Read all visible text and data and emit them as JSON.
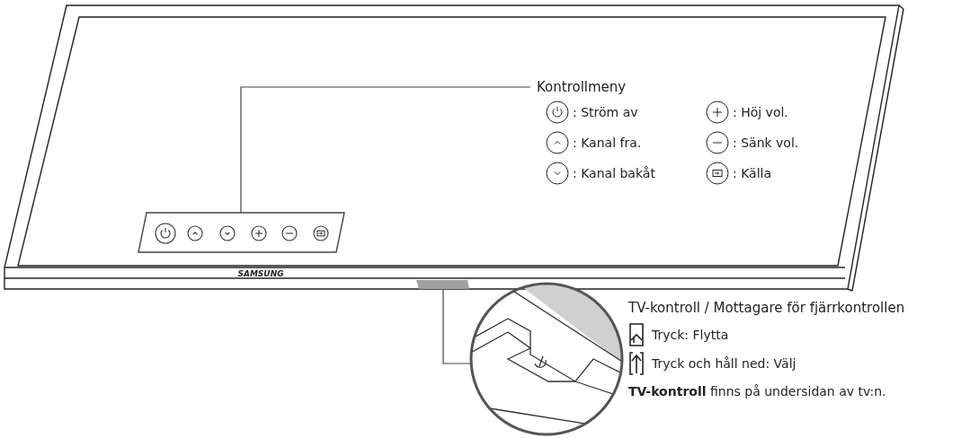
{
  "tv_logo": "SAMSUNG",
  "control_menu": {
    "title": "Kontrollmeny",
    "items": [
      {
        "kind": "power",
        "label": ": Ström av"
      },
      {
        "kind": "plus",
        "label": ": Höj vol."
      },
      {
        "kind": "up",
        "label": ": Kanal fra."
      },
      {
        "kind": "minus",
        "label": ": Sänk vol."
      },
      {
        "kind": "down",
        "label": ": Kanal bakåt"
      },
      {
        "kind": "source",
        "label": ": Källa"
      }
    ],
    "panel_buttons": [
      {
        "kind": "power"
      },
      {
        "kind": "up"
      },
      {
        "kind": "down"
      },
      {
        "kind": "plus"
      },
      {
        "kind": "minus"
      },
      {
        "kind": "source"
      }
    ]
  },
  "tv_controller": {
    "title": "TV-kontroll / Mottagare för fjärrkontrollen",
    "actions": [
      {
        "kind": "press",
        "label": "Tryck: Flytta"
      },
      {
        "kind": "hold",
        "label": "Tryck och håll ned: Välj"
      }
    ],
    "note": "**TV-kontroll** finns på undersidan av tv:n."
  }
}
